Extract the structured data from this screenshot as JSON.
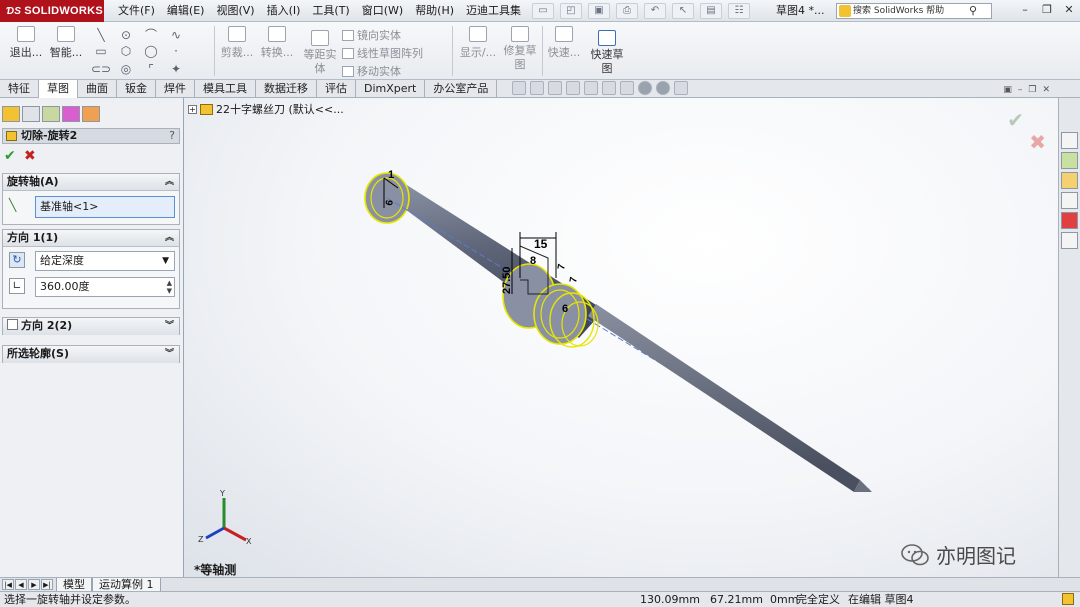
{
  "app": {
    "brand": "SOLIDWORKS",
    "menus": [
      "文件(F)",
      "编辑(E)",
      "视图(V)",
      "插入(I)",
      "工具(T)",
      "窗口(W)",
      "帮助(H)",
      "迈迪工具集"
    ],
    "document_title": "草图4 *...",
    "search_placeholder": "搜索 SolidWorks 帮助"
  },
  "ribbon": {
    "exit_sketch": "退出...",
    "smart_dim": "智能...",
    "trim": "剪裁...",
    "convert": "转换...",
    "offset_line1": "等距实",
    "offset_line2": "体",
    "mirror": "镜向实体",
    "linear_pattern": "线性草图阵列",
    "move": "移动实体",
    "display": "显示/...",
    "repair_line1": "修复草",
    "repair_line2": "图",
    "quick_snap": "快速...",
    "rapid_sketch_line1": "快速草",
    "rapid_sketch_line2": "图"
  },
  "tabs": [
    "特征",
    "草图",
    "曲面",
    "钣金",
    "焊件",
    "模具工具",
    "数据迁移",
    "评估",
    "DimXpert",
    "办公室产品"
  ],
  "active_tab": "草图",
  "property_manager": {
    "title": "切除-旋转2",
    "help": "?",
    "axis_group": "旋转轴(A)",
    "axis_value": "基准轴<1>",
    "dir1_group": "方向 1(1)",
    "end_condition": "给定深度",
    "angle": "360.00度",
    "dir2_group": "方向 2(2)",
    "contours_group": "所选轮廓(S)"
  },
  "viewport": {
    "tree_root": "22十字螺丝刀 (默认<<...",
    "view_orientation": "*等轴测",
    "dimensions": [
      "1",
      "6",
      "15",
      "8",
      "7",
      "27.50",
      "7",
      "6"
    ]
  },
  "bottom_tabs": [
    "模型",
    "运动算例 1"
  ],
  "status": {
    "hint": "选择一旋转轴并设定参数。",
    "x": "130.09mm",
    "y": "67.21mm",
    "z": "0mm",
    "constraint": "完全定义",
    "editing": "在编辑 草图4"
  },
  "watermark": "亦明图记",
  "colors": {
    "brand_red": "#b0121b",
    "selection_yellow": "#e6e600",
    "dimension_black": "#000000",
    "ok_green": "#2e9a2e",
    "cancel_red": "#c42020"
  }
}
